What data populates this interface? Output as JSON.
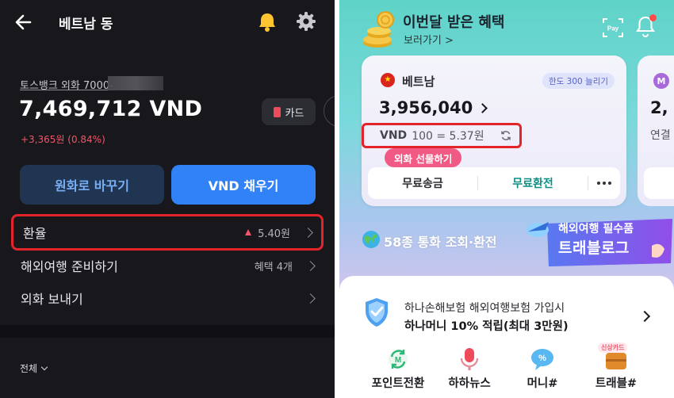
{
  "left_app": {
    "header": {
      "title": "베트남 동"
    },
    "account": {
      "name": "토스뱅크 외화 7000-",
      "balance": "7,469,712 VND",
      "change": "+3,365원 (0.84%)",
      "card_label": "카드"
    },
    "buttons": {
      "convert": "원화로 바꾸기",
      "fill": "VND 채우기"
    },
    "menu": [
      {
        "label": "환율",
        "value": "5.40원",
        "trend": "up"
      },
      {
        "label": "해외여행 준비하기",
        "value": "혜택 4개"
      },
      {
        "label": "외화 보내기",
        "value": ""
      }
    ],
    "filter": {
      "label": "전체"
    },
    "colors": {
      "accent_blue": "#3182f6",
      "positive_red": "#f0566a",
      "highlight_border": "#e3242b",
      "background": "#17171c"
    }
  },
  "right_app": {
    "banner": {
      "title": "이번달 받은 혜택",
      "subtitle": "보러가기 >"
    },
    "pay_icon_label": "Pay",
    "currency_card": {
      "country": "베트남",
      "limit_badge": "한도 300 늘리기",
      "amount": "3,956,040",
      "rate_currency": "VND",
      "rate_text": "100 = 5.37원",
      "futures_label": "외화 선물하기",
      "actions": [
        "무료송금",
        "무료환전"
      ]
    },
    "next_card": {
      "avatar_letter": "M",
      "amount_partial": "2,",
      "label_partial": "연결"
    },
    "currency_info": "58종 통화 조회·환전",
    "travel_banner": {
      "line1": "해외여행 필수품",
      "line2": "트래블로그"
    },
    "insurance": {
      "line1": "하나손해보험 해외여행보험 가입시",
      "line2": "하나머니 10% 적립(최대 3만원)"
    },
    "services": [
      {
        "label": "포인트전환",
        "icon": "point-exchange-icon"
      },
      {
        "label": "하하뉴스",
        "icon": "microphone-icon"
      },
      {
        "label": "머니#",
        "icon": "money-bubble-icon"
      },
      {
        "label": "트래블#",
        "icon": "suitcase-icon",
        "tag": "신상카드"
      }
    ],
    "colors": {
      "teal": "#5fd3c8",
      "pink_pill": "#f05a84",
      "green_action": "#0f8f84",
      "highlight_border": "#e3242b"
    }
  }
}
